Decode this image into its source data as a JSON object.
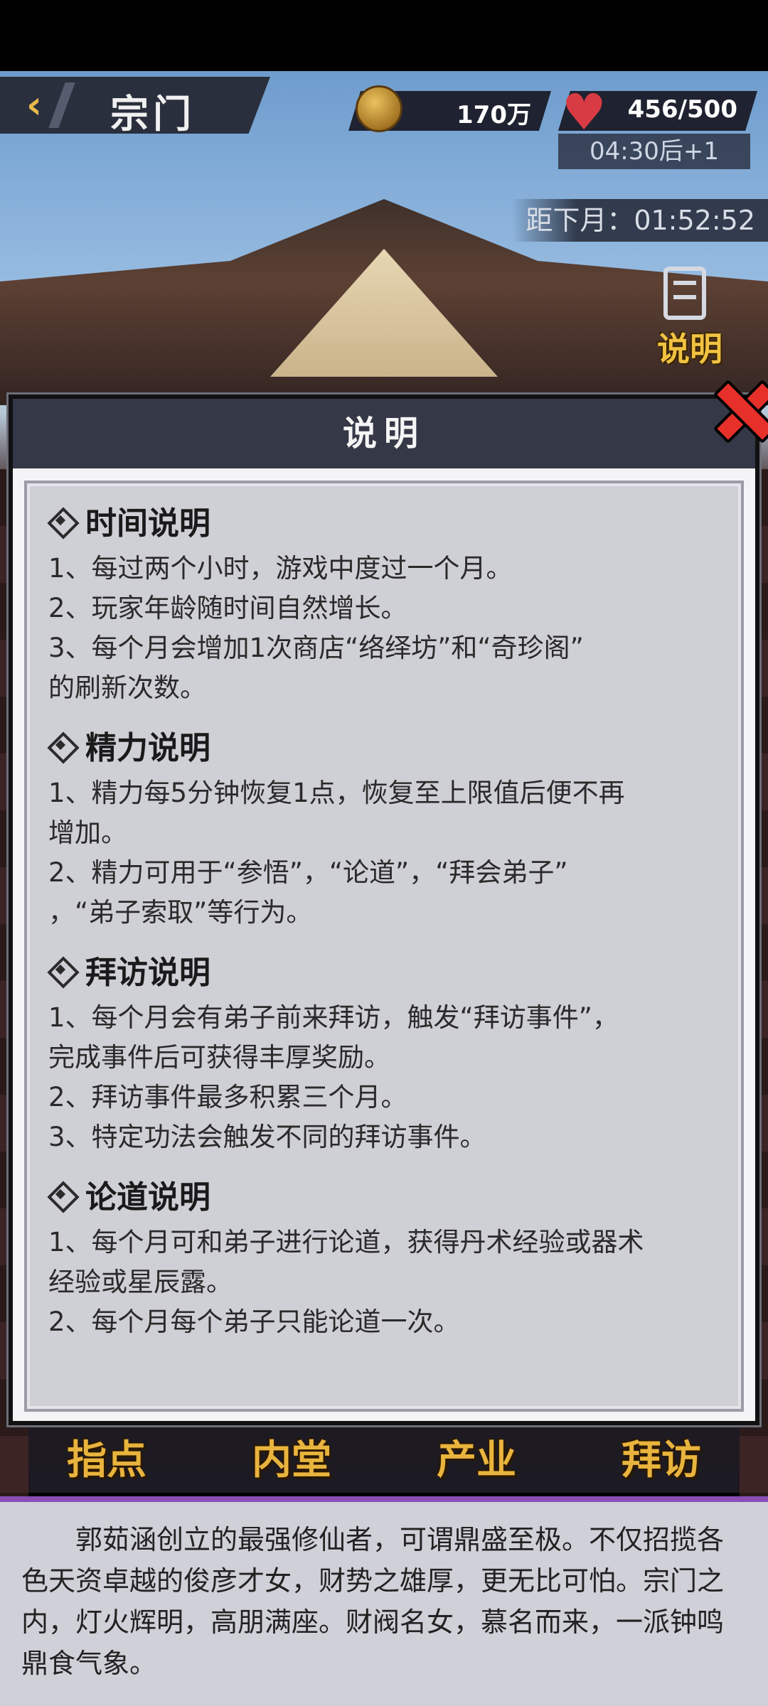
{
  "header": {
    "title": "宗门",
    "currency_value": "170万",
    "stamina_value": "456/500",
    "stamina_timer": "04:30后+1",
    "month_countdown": "距下月：01:52:52",
    "help_label": "说明"
  },
  "dialog": {
    "title": "说明",
    "sections": [
      {
        "title": "时间说明",
        "lines": [
          "1、每过两个小时，游戏中度过一个月。",
          "2、玩家年龄随时间自然增长。",
          "3、每个月会增加1次商店“络绎坊”和“奇珍阁”",
          "的刷新次数。"
        ]
      },
      {
        "title": "精力说明",
        "lines": [
          "1、精力每5分钟恢复1点，恢复至上限值后便不再",
          "增加。",
          "2、精力可用于“参悟”，“论道”，“拜会弟子”",
          "，“弟子索取”等行为。"
        ]
      },
      {
        "title": "拜访说明",
        "lines": [
          "1、每个月会有弟子前来拜访，触发“拜访事件”，",
          "完成事件后可获得丰厚奖励。",
          "2、拜访事件最多积累三个月。",
          "3、特定功法会触发不同的拜访事件。"
        ]
      },
      {
        "title": "论道说明",
        "lines": [
          "1、每个月可和弟子进行论道，获得丹术经验或器术",
          "经验或星辰露。",
          "2、每个月每个弟子只能论道一次。"
        ]
      }
    ]
  },
  "tabs": [
    "指点",
    "内堂",
    "产业",
    "拜访"
  ],
  "lore": "郭茹涵创立的最强修仙者，可谓鼎盛至极。不仅招揽各色天资卓越的俊彦才女，财势之雄厚，更无比可怕。宗门之内，灯火辉明，高朋满座。财阀名女，慕名而来，一派钟鸣鼎食气象。"
}
